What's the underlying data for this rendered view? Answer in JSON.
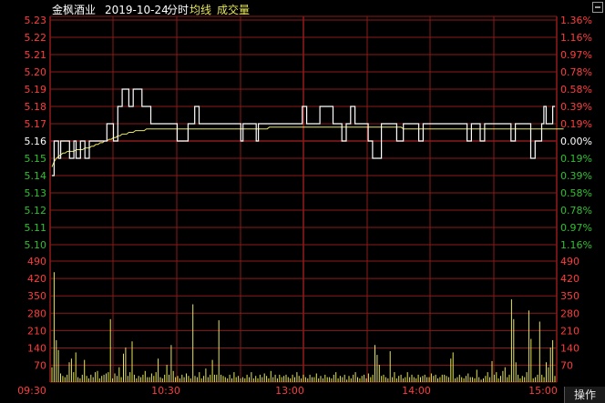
{
  "header": {
    "stock_name": "金枫酒业",
    "date": "2019-10-24",
    "mode": "分时",
    "legend_avg": "均线",
    "legend_volume": "成交量"
  },
  "buttons": {
    "operate": "操作"
  },
  "icons": {
    "window": "window-restore-icon"
  },
  "colors": {
    "background": "#000000",
    "grid": "#8b1a1a",
    "price_line": "#ffffff",
    "avg_line": "#e6e65a",
    "volume_bar": "#e6e65a",
    "up_text": "#ff3c3c",
    "down_text": "#2fc02f",
    "neutral_text": "#ffffff",
    "title_text": "#ffffff",
    "legend_text": "#e6e65a",
    "time_text": "#ff3c3c"
  },
  "chart_data": {
    "type": "line",
    "prev_close": 5.16,
    "price_axis": [
      "5.23",
      "5.22",
      "5.21",
      "5.20",
      "5.19",
      "5.18",
      "5.17",
      "5.16",
      "5.15",
      "5.14",
      "5.13",
      "5.12",
      "5.11",
      "5.10"
    ],
    "pct_axis": [
      "1.36%",
      "1.16%",
      "0.97%",
      "0.78%",
      "0.58%",
      "0.39%",
      "0.19%",
      "0.00%",
      "0.19%",
      "0.39%",
      "0.58%",
      "0.78%",
      "0.97%",
      "1.16%"
    ],
    "volume_axis": [
      "490",
      "420",
      "350",
      "280",
      "210",
      "140",
      "70"
    ],
    "ylim_price": [
      5.1,
      5.23
    ],
    "ylim_volume": [
      0,
      490
    ],
    "time_labels": [
      "09:30",
      "10:30",
      "13:00",
      "14:00",
      "15:00"
    ],
    "grid": true,
    "price": [
      5.14,
      5.16,
      5.16,
      5.15,
      5.16,
      5.16,
      5.16,
      5.16,
      5.15,
      5.15,
      5.16,
      5.15,
      5.15,
      5.16,
      5.16,
      5.15,
      5.15,
      5.16,
      5.16,
      5.16,
      5.16,
      5.16,
      5.16,
      5.16,
      5.16,
      5.17,
      5.17,
      5.17,
      5.16,
      5.16,
      5.18,
      5.18,
      5.19,
      5.19,
      5.19,
      5.18,
      5.18,
      5.19,
      5.19,
      5.19,
      5.19,
      5.18,
      5.18,
      5.18,
      5.18,
      5.17,
      5.17,
      5.17,
      5.17,
      5.17,
      5.17,
      5.17,
      5.17,
      5.17,
      5.17,
      5.17,
      5.17,
      5.16,
      5.16,
      5.16,
      5.16,
      5.16,
      5.17,
      5.17,
      5.17,
      5.18,
      5.18,
      5.17,
      5.17,
      5.17,
      5.17,
      5.17,
      5.17,
      5.17,
      5.17,
      5.17,
      5.17,
      5.17,
      5.17,
      5.17,
      5.17,
      5.17,
      5.17,
      5.17,
      5.17,
      5.17,
      5.16,
      5.17,
      5.17,
      5.17,
      5.17,
      5.17,
      5.17,
      5.16,
      5.17,
      5.17,
      5.17,
      5.17,
      5.17,
      5.17,
      5.17,
      5.17,
      5.17,
      5.17,
      5.17,
      5.17,
      5.17,
      5.17,
      5.17,
      5.17,
      5.17,
      5.17,
      5.17,
      5.17,
      5.18,
      5.18,
      5.17,
      5.17,
      5.17,
      5.17,
      5.17,
      5.17,
      5.18,
      5.18,
      5.18,
      5.18,
      5.18,
      5.18,
      5.17,
      5.17,
      5.17,
      5.17,
      5.16,
      5.16,
      5.17,
      5.17,
      5.18,
      5.18,
      5.17,
      5.17,
      5.17,
      5.17,
      5.17,
      5.17,
      5.16,
      5.16,
      5.15,
      5.15,
      5.15,
      5.15,
      5.17,
      5.17,
      5.17,
      5.17,
      5.17,
      5.17,
      5.17,
      5.16,
      5.16,
      5.16,
      5.17,
      5.17,
      5.17,
      5.17,
      5.17,
      5.17,
      5.17,
      5.16,
      5.16,
      5.17,
      5.17,
      5.17,
      5.17,
      5.17,
      5.17,
      5.17,
      5.17,
      5.17,
      5.17,
      5.17,
      5.17,
      5.17,
      5.17,
      5.17,
      5.17,
      5.17,
      5.17,
      5.17,
      5.17,
      5.16,
      5.16,
      5.17,
      5.17,
      5.17,
      5.17,
      5.16,
      5.16,
      5.17,
      5.17,
      5.17,
      5.17,
      5.17,
      5.17,
      5.17,
      5.17,
      5.17,
      5.17,
      5.17,
      5.17,
      5.16,
      5.16,
      5.17,
      5.17,
      5.17,
      5.17,
      5.17,
      5.17,
      5.17,
      5.15,
      5.15,
      5.16,
      5.16,
      5.16,
      5.17,
      5.18,
      5.17,
      5.17,
      5.17,
      5.18,
      5.18
    ],
    "avg_price": [
      5.145,
      5.148,
      5.15,
      5.151,
      5.152,
      5.153,
      5.153,
      5.154,
      5.154,
      5.154,
      5.154,
      5.155,
      5.155,
      5.155,
      5.155,
      5.156,
      5.156,
      5.156,
      5.157,
      5.157,
      5.158,
      5.158,
      5.159,
      5.159,
      5.16,
      5.16,
      5.161,
      5.161,
      5.162,
      5.162,
      5.163,
      5.163,
      5.164,
      5.164,
      5.164,
      5.165,
      5.165,
      5.165,
      5.166,
      5.166,
      5.166,
      5.166,
      5.166,
      5.167,
      5.167,
      5.167,
      5.167,
      5.167,
      5.167,
      5.167,
      5.167,
      5.167,
      5.167,
      5.167,
      5.167,
      5.167,
      5.167,
      5.167,
      5.167,
      5.167,
      5.167,
      5.167,
      5.167,
      5.167,
      5.167,
      5.167,
      5.167,
      5.167,
      5.167,
      5.167,
      5.167,
      5.167,
      5.167,
      5.167,
      5.167,
      5.167,
      5.167,
      5.167,
      5.167,
      5.167,
      5.167,
      5.167,
      5.167,
      5.167,
      5.167,
      5.167,
      5.167,
      5.167,
      5.167,
      5.167,
      5.167,
      5.167,
      5.167,
      5.167,
      5.167,
      5.167,
      5.167,
      5.167,
      5.167,
      5.168,
      5.168,
      5.168,
      5.168,
      5.168,
      5.168,
      5.168,
      5.168,
      5.168,
      5.168,
      5.168,
      5.168,
      5.168,
      5.168,
      5.168,
      5.168,
      5.168,
      5.168,
      5.168,
      5.168,
      5.168,
      5.168,
      5.168,
      5.168,
      5.168,
      5.168,
      5.168,
      5.168,
      5.168,
      5.168,
      5.168,
      5.168,
      5.168,
      5.168,
      5.168,
      5.168,
      5.168,
      5.168,
      5.168,
      5.168,
      5.168,
      5.168,
      5.168,
      5.168,
      5.168,
      5.168,
      5.168,
      5.168,
      5.168,
      5.168,
      5.168,
      5.168,
      5.168,
      5.168,
      5.168,
      5.168,
      5.168,
      5.168,
      5.168,
      5.168,
      5.168,
      5.167,
      5.167,
      5.167,
      5.167,
      5.167,
      5.167,
      5.167,
      5.167,
      5.167,
      5.167,
      5.167,
      5.167,
      5.167,
      5.167,
      5.167,
      5.167,
      5.167,
      5.167,
      5.167,
      5.167,
      5.167,
      5.167,
      5.167,
      5.167,
      5.167,
      5.167,
      5.167,
      5.167,
      5.167,
      5.167,
      5.167,
      5.167,
      5.167,
      5.167,
      5.167,
      5.167,
      5.167,
      5.167,
      5.167,
      5.167,
      5.167,
      5.167,
      5.167,
      5.167,
      5.167,
      5.167,
      5.167,
      5.167,
      5.167,
      5.167,
      5.167,
      5.167,
      5.167,
      5.167,
      5.167,
      5.167,
      5.167,
      5.167,
      5.167,
      5.167,
      5.167,
      5.167,
      5.167,
      5.167,
      5.167,
      5.167,
      5.167,
      5.167,
      5.167,
      5.167,
      5.167,
      5.167,
      5.167,
      5.167
    ],
    "volume": [
      60,
      445,
      170,
      130,
      35,
      25,
      20,
      30,
      80,
      95,
      40,
      120,
      20,
      15,
      30,
      90,
      25,
      15,
      30,
      20,
      40,
      45,
      15,
      25,
      30,
      35,
      40,
      255,
      15,
      35,
      25,
      60,
      20,
      115,
      140,
      25,
      40,
      165,
      30,
      15,
      25,
      20,
      30,
      45,
      20,
      20,
      35,
      25,
      40,
      95,
      20,
      15,
      30,
      70,
      30,
      150,
      45,
      20,
      25,
      15,
      30,
      20,
      35,
      25,
      15,
      315,
      25,
      20,
      40,
      15,
      25,
      55,
      20,
      30,
      90,
      30,
      30,
      250,
      30,
      25,
      20,
      15,
      30,
      15,
      40,
      20,
      25,
      15,
      20,
      15,
      30,
      20,
      40,
      15,
      25,
      15,
      30,
      20,
      35,
      25,
      15,
      45,
      20,
      30,
      15,
      30,
      20,
      25,
      30,
      20,
      15,
      30,
      20,
      40,
      25,
      15,
      30,
      20,
      15,
      30,
      20,
      20,
      35,
      15,
      25,
      15,
      30,
      20,
      20,
      15,
      30,
      40,
      15,
      25,
      20,
      30,
      10,
      25,
      15,
      30,
      40,
      20,
      15,
      25,
      30,
      15,
      35,
      20,
      30,
      150,
      110,
      70,
      25,
      30,
      20,
      15,
      125,
      20,
      40,
      15,
      25,
      30,
      15,
      20,
      40,
      20,
      30,
      20,
      15,
      30,
      20,
      25,
      30,
      20,
      20,
      35,
      25,
      30,
      15,
      20,
      30,
      30,
      25,
      20,
      95,
      120,
      15,
      20,
      30,
      20,
      15,
      25,
      35,
      20,
      20,
      15,
      50,
      20,
      10,
      15,
      25,
      40,
      20,
      85,
      30,
      40,
      15,
      25,
      45,
      60,
      20,
      30,
      335,
      255,
      80,
      30,
      15,
      25,
      20,
      40,
      290,
      175,
      15,
      20,
      30,
      245,
      30,
      20,
      80,
      60,
      140,
      170,
      25
    ]
  }
}
